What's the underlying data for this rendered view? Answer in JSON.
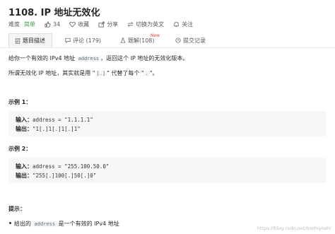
{
  "problem": {
    "title": "1108. IP 地址无效化",
    "difficulty_label": "难度",
    "difficulty_value": "简单",
    "like_count": "34",
    "favorite_label": "收藏",
    "share_label": "分享",
    "switch_lang_label": "切换为英文",
    "follow_label": "关注"
  },
  "tabs": [
    {
      "label": "题目描述"
    },
    {
      "label": "评论 (179)"
    },
    {
      "label": "题解(108)"
    },
    {
      "label": "提交记录"
    }
  ],
  "new_badge": "New",
  "description": {
    "line1_pre": "给你一个有效的 IPv4 地址 ",
    "line1_code": "address",
    "line1_post": "，返回这个 IP 地址的无效化版本。",
    "line2_pre": "所谓无效化 IP 地址，其实就是用 \"",
    "line2_code1": "[.]",
    "line2_mid": "\" 代替了每个 \"",
    "line2_code2": ".",
    "line2_post": "\"。"
  },
  "examples": [
    {
      "heading": "示例 1：",
      "input_label": "输入：",
      "input_value": "address = \"1.1.1.1\"",
      "output_label": "输出：",
      "output_value": "\"1[.]1[.]1[.]1\""
    },
    {
      "heading": "示例 2：",
      "input_label": "输入：",
      "input_value": "address = \"255.100.50.0\"",
      "output_label": "输出：",
      "output_value": "\"255[.]100[.]50[.]0\""
    }
  ],
  "hints": {
    "heading": "提示：",
    "item_pre": "给出的 ",
    "item_code": "address",
    "item_post": " 是一个有效的 IPv4 地址"
  },
  "watermark": "https://blog.csdn.net/hoshiyoshi",
  "colors": {
    "easy": "#43a047",
    "new_badge": "#f44336",
    "code_bg": "#f7f7f7"
  }
}
